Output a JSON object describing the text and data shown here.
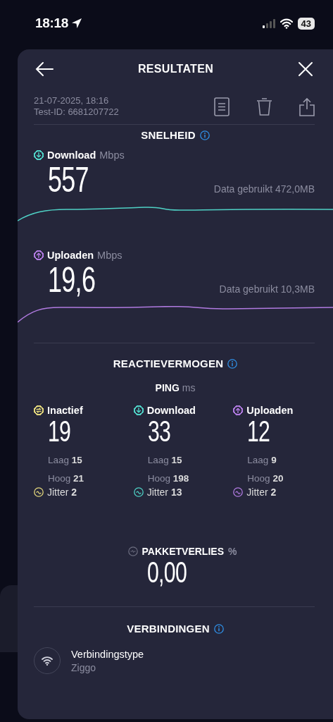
{
  "status_bar": {
    "time": "18:18",
    "battery": "43"
  },
  "header": {
    "title": "RESULTATEN"
  },
  "meta": {
    "date": "21-07-2025, 18:16",
    "test_id": "Test-ID: 6681207722"
  },
  "speed": {
    "title": "SNELHEID",
    "tests": [
      {
        "kind": "download",
        "label": "Download",
        "unit": "Mbps",
        "value": "557",
        "data_used": "Data gebruikt 472,0MB",
        "color": "#4fd1c5"
      },
      {
        "kind": "upload",
        "label": "Uploaden",
        "unit": "Mbps",
        "value": "19,6",
        "data_used": "Data gebruikt 10,3MB",
        "color": "#b07ae0"
      }
    ]
  },
  "responsiveness": {
    "title": "REACTIEVERMOGEN",
    "ping_label": "PING",
    "ping_unit": "ms",
    "columns": [
      {
        "kind": "idle",
        "label": "Inactief",
        "value": "19",
        "low": "Laag **15**",
        "high": "Hoog **21**",
        "jitter": "Jitter **2**",
        "color": "#e3d77c"
      },
      {
        "kind": "download",
        "label": "Download",
        "value": "33",
        "low": "Laag **15**",
        "high": "Hoog **198**",
        "jitter": "Jitter **13**",
        "color": "#4fd1c5"
      },
      {
        "kind": "upload",
        "label": "Uploaden",
        "value": "12",
        "low": "Laag **9**",
        "high": "Hoog **20**",
        "jitter": "Jitter **2**",
        "color": "#b07ae0"
      }
    ]
  },
  "packet_loss": {
    "label": "PAKKETVERLIES",
    "unit": "%",
    "value": "0,00"
  },
  "connections": {
    "title": "VERBINDINGEN",
    "items": [
      {
        "label": "Verbindingstype",
        "value": "Ziggo"
      }
    ]
  }
}
